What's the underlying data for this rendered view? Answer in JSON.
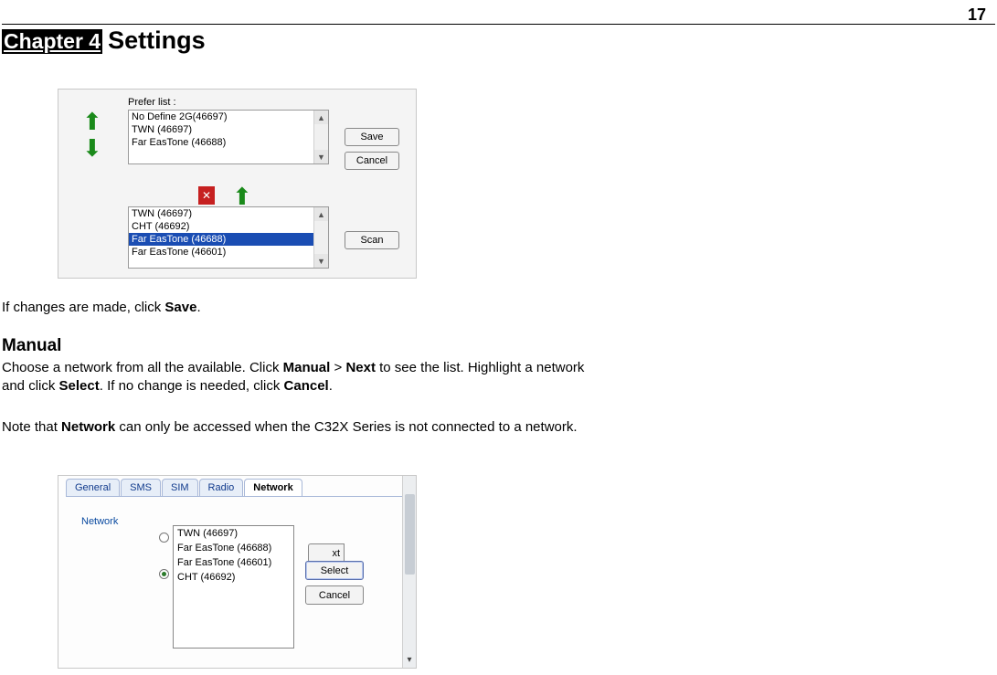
{
  "page_number": "17",
  "chapter": {
    "label": "Chapter 4",
    "title": "Settings"
  },
  "figure1": {
    "prefer_label": "Prefer list :",
    "prefer_items": [
      "No Define 2G(46697)",
      "TWN (46697)",
      "Far EasTone (46688)"
    ],
    "available_items": [
      {
        "label": "TWN (46697)",
        "selected": false
      },
      {
        "label": "CHT (46692)",
        "selected": false
      },
      {
        "label": "Far EasTone (46688)",
        "selected": true
      },
      {
        "label": "Far EasTone (46601)",
        "selected": false
      }
    ],
    "buttons": {
      "save": "Save",
      "cancel": "Cancel",
      "scan": "Scan"
    }
  },
  "text": {
    "if_changes_prefix": "If changes are made, click ",
    "if_changes_bold": "Save",
    "if_changes_suffix": ".",
    "manual_heading": "Manual",
    "manual_para_parts": {
      "p1": "Choose a network from all the available. Click ",
      "b1": "Manual",
      "p2": " > ",
      "b2": "Next",
      "p3": " to see the list. Highlight a network and click ",
      "b3": "Select",
      "p4": ". If no change is needed, click ",
      "b4": "Cancel",
      "p5": "."
    },
    "note_parts": {
      "p1": "Note that ",
      "b1": "Network",
      "p2": " can only be accessed when the C32X Series is not connected to a network."
    }
  },
  "figure2": {
    "tabs": [
      {
        "label": "General",
        "active": false
      },
      {
        "label": "SMS",
        "active": false
      },
      {
        "label": "SIM",
        "active": false
      },
      {
        "label": "Radio",
        "active": false
      },
      {
        "label": "Network",
        "active": true
      }
    ],
    "network_label": "Network",
    "popup_items": [
      "TWN (46697)",
      "Far EasTone (46688)",
      "Far EasTone (46601)",
      "CHT (46692)"
    ],
    "buttons": {
      "next_clip": "xt",
      "select": "Select",
      "cancel": "Cancel"
    }
  }
}
